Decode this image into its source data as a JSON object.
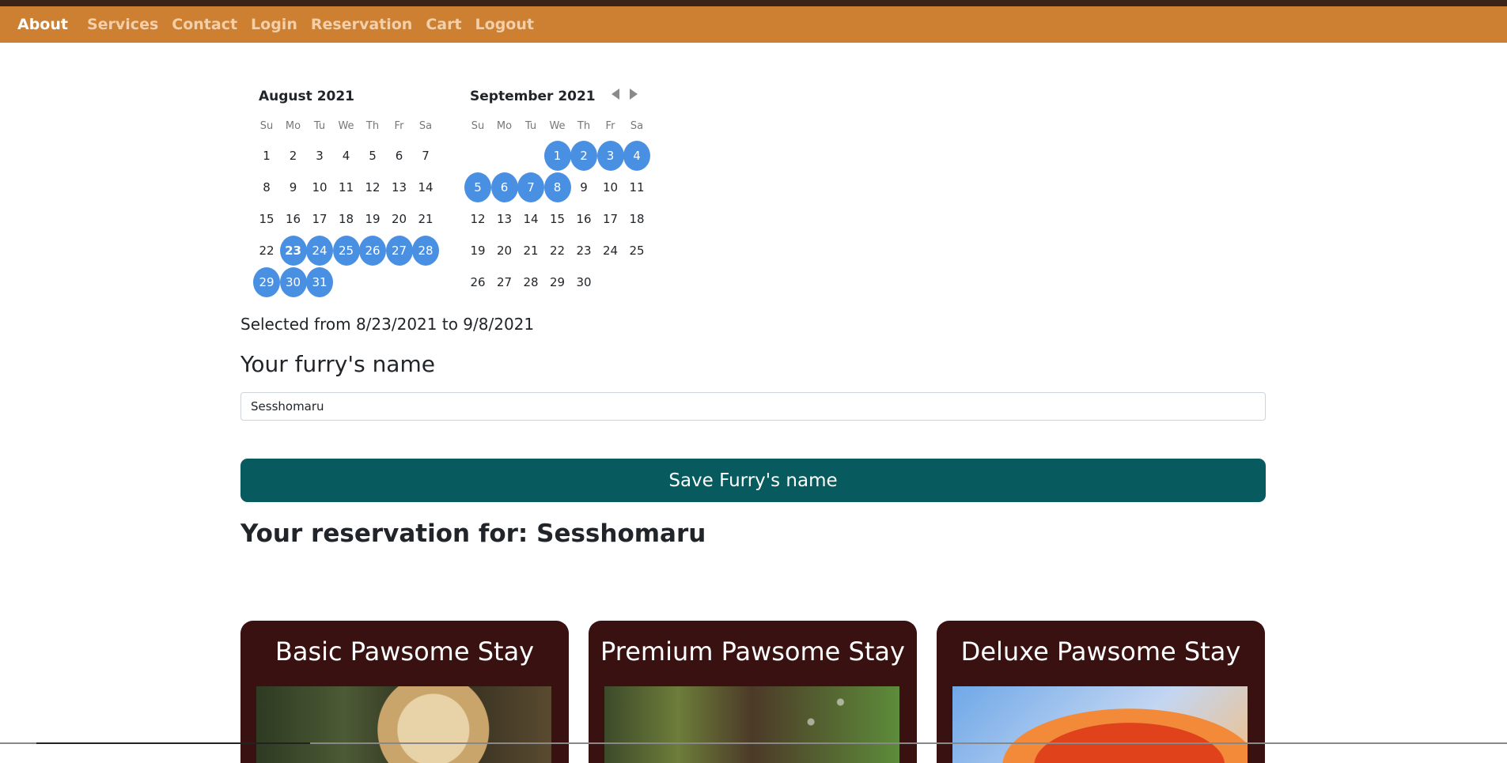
{
  "nav": {
    "brand": "About",
    "links": [
      "Services",
      "Contact",
      "Login",
      "Reservation",
      "Cart",
      "Logout"
    ]
  },
  "calendar": {
    "months": [
      {
        "title": "August 2021",
        "dow": [
          "Su",
          "Mo",
          "Tu",
          "We",
          "Th",
          "Fr",
          "Sa"
        ],
        "weeks": [
          [
            "1",
            "2",
            "3",
            "4",
            "5",
            "6",
            "7"
          ],
          [
            "8",
            "9",
            "10",
            "11",
            "12",
            "13",
            "14"
          ],
          [
            "15",
            "16",
            "17",
            "18",
            "19",
            "20",
            "21"
          ],
          [
            "22",
            "23",
            "24",
            "25",
            "26",
            "27",
            "28"
          ],
          [
            "29",
            "30",
            "31"
          ]
        ]
      },
      {
        "title": "September 2021",
        "dow": [
          "Su",
          "Mo",
          "Tu",
          "We",
          "Th",
          "Fr",
          "Sa"
        ],
        "weeks": [
          [
            "",
            "",
            "",
            "1",
            "2",
            "3",
            "4"
          ],
          [
            "5",
            "6",
            "7",
            "8",
            "9",
            "10",
            "11"
          ],
          [
            "12",
            "13",
            "14",
            "15",
            "16",
            "17",
            "18"
          ],
          [
            "19",
            "20",
            "21",
            "22",
            "23",
            "24",
            "25"
          ],
          [
            "26",
            "27",
            "28",
            "29",
            "30"
          ]
        ]
      }
    ],
    "range_start": "8/23/2021",
    "range_end": "9/8/2021",
    "accent_color": "#4a90e2"
  },
  "selection_text": "Selected from 8/23/2021 to 9/8/2021",
  "form": {
    "label": "Your furry's name",
    "name_value": "Sesshomaru",
    "save_label": "Save Furry's name"
  },
  "reservation_heading": "Your reservation for: Sesshomaru",
  "cards": [
    {
      "title": "Basic Pawsome Stay"
    },
    {
      "title": "Premium Pawsome Stay"
    },
    {
      "title": "Deluxe Pawsome Stay"
    }
  ],
  "colors": {
    "navbar": "#cd7f32",
    "save_button": "#075a5d",
    "card_background": "#3a1111"
  }
}
